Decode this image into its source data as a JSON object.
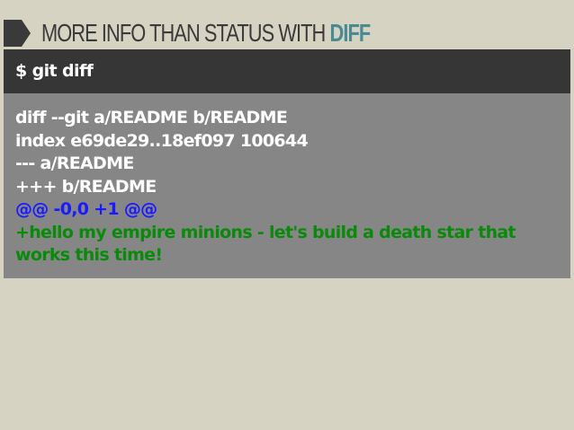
{
  "slide": {
    "title_main": "MORE INFO THAN STATUS WITH ",
    "title_accent": "DIFF",
    "title_icon": "chevron-arrow-icon",
    "accent_color": "#4a8a92",
    "background_color": "#d6d3c2"
  },
  "terminal": {
    "command": "$ git diff",
    "command_bar_color": "#363636",
    "output_panel_color": "#868686",
    "output": [
      {
        "type": "meta",
        "text": "diff --git a/README b/README",
        "color": "#ffffff"
      },
      {
        "type": "meta",
        "text": "index e69de29..18ef097 100644",
        "color": "#ffffff"
      },
      {
        "type": "meta",
        "text": "--- a/README",
        "color": "#ffffff"
      },
      {
        "type": "meta",
        "text": "+++ b/README",
        "color": "#ffffff"
      },
      {
        "type": "hunk",
        "text": "@@ -0,0 +1 @@",
        "color": "#1a1aff"
      },
      {
        "type": "add",
        "text": "+hello my empire minions - let's build a death star that works this time!",
        "color": "#0a8a0a"
      }
    ]
  }
}
